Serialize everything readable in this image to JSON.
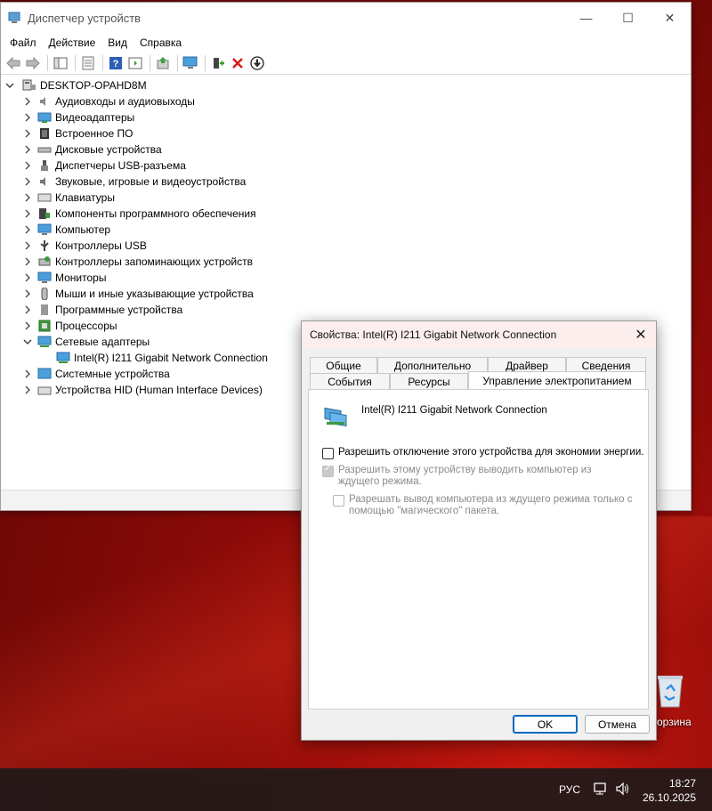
{
  "window": {
    "title": "Диспетчер устройств",
    "controls": {
      "minimize": "—",
      "maximize": "☐",
      "close": "✕"
    }
  },
  "menu": [
    "Файл",
    "Действие",
    "Вид",
    "Справка"
  ],
  "tree": {
    "root": "DESKTOP-OPAHD8M",
    "categories": [
      {
        "label": "Аудиовходы и аудиовыходы",
        "icon": "speaker-icon"
      },
      {
        "label": "Видеоадаптеры",
        "icon": "display-adapter-icon"
      },
      {
        "label": "Встроенное ПО",
        "icon": "firmware-icon"
      },
      {
        "label": "Дисковые устройства",
        "icon": "disk-drive-icon"
      },
      {
        "label": "Диспетчеры USB-разъема",
        "icon": "usb-connector-icon"
      },
      {
        "label": "Звуковые, игровые и видеоустройства",
        "icon": "sound-icon"
      },
      {
        "label": "Клавиатуры",
        "icon": "keyboard-icon"
      },
      {
        "label": "Компоненты программного обеспечения",
        "icon": "software-component-icon"
      },
      {
        "label": "Компьютер",
        "icon": "computer-icon"
      },
      {
        "label": "Контроллеры USB",
        "icon": "usb-icon"
      },
      {
        "label": "Контроллеры запоминающих устройств",
        "icon": "storage-controller-icon"
      },
      {
        "label": "Мониторы",
        "icon": "monitor-icon"
      },
      {
        "label": "Мыши и иные указывающие устройства",
        "icon": "mouse-icon"
      },
      {
        "label": "Программные устройства",
        "icon": "software-device-icon"
      },
      {
        "label": "Процессоры",
        "icon": "processor-icon"
      },
      {
        "label": "Сетевые адаптеры",
        "icon": "network-adapter-icon",
        "expanded": true,
        "children": [
          "Intel(R) I211 Gigabit Network Connection"
        ]
      },
      {
        "label": "Системные устройства",
        "icon": "system-device-icon"
      },
      {
        "label": "Устройства HID (Human Interface Devices)",
        "icon": "hid-icon"
      }
    ]
  },
  "dialog": {
    "title": "Свойства: Intel(R) I211 Gigabit Network Connection",
    "tabs_back": [
      "Общие",
      "Дополнительно",
      "Драйвер",
      "Сведения"
    ],
    "tabs_front": [
      "События",
      "Ресурсы",
      "Управление электропитанием"
    ],
    "device_name": "Intel(R) I211 Gigabit Network Connection",
    "opt_allow_off": "Разрешить отключение этого устройства для экономии энергии.",
    "opt_wake": "Разрешить этому устройству выводить компьютер из ждущего режима.",
    "opt_magic": "Разрешать вывод компьютера из ждущего режима только с помощью \"магического\" пакета.",
    "ok": "OK",
    "cancel": "Отмена"
  },
  "desktop": {
    "recycle_label": "орзина"
  },
  "taskbar": {
    "lang": "РУС",
    "time": "18:27",
    "date": "26.10.2025"
  }
}
